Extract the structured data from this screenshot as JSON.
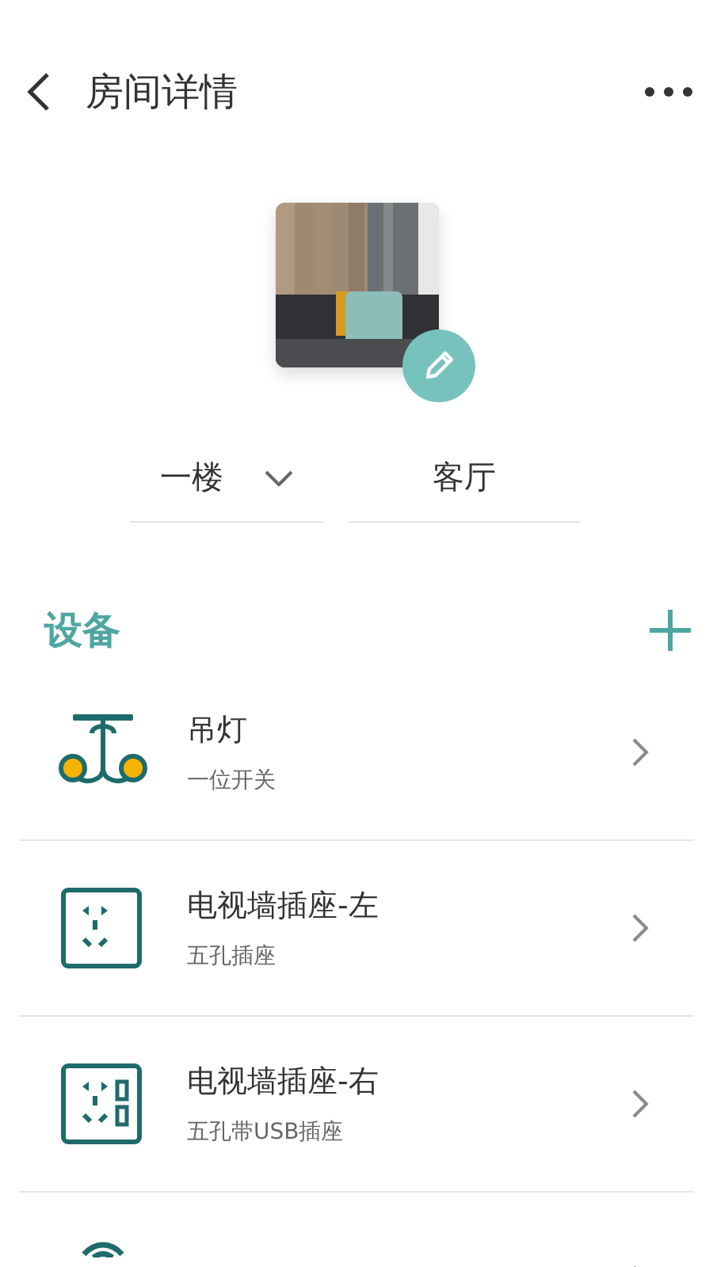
{
  "header": {
    "title": "房间详情"
  },
  "room": {
    "kind": "picture",
    "floor": "一楼",
    "name": "客厅"
  },
  "section": {
    "title": "设备"
  },
  "devices": [
    {
      "kind": "pendant",
      "name": "吊灯",
      "type": "一位开关"
    },
    {
      "kind": "socket",
      "name": "电视墙插座-左",
      "type": "五孔插座"
    },
    {
      "kind": "socket_usb",
      "name": "电视墙插座-右",
      "type": "五孔带USB插座"
    },
    {
      "kind": "wifi"
    }
  ]
}
